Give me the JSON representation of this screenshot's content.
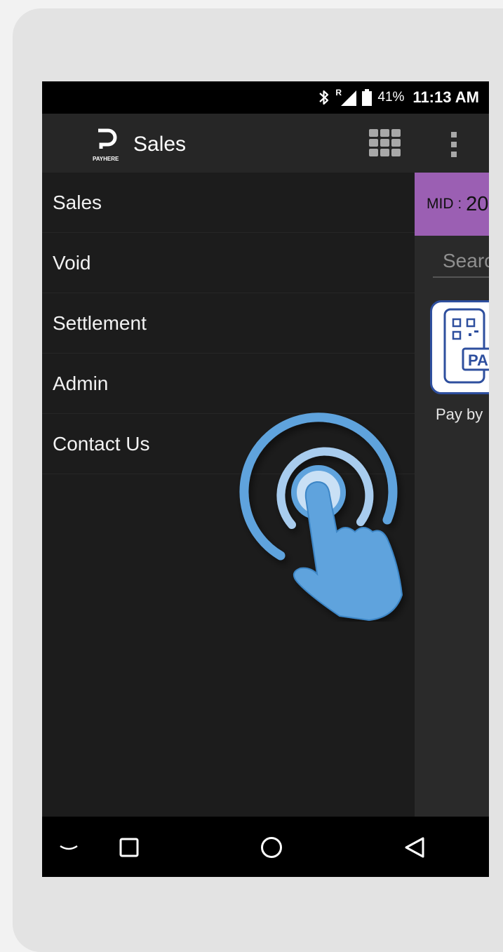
{
  "status_bar": {
    "roaming": "R",
    "battery_percent": "41%",
    "time": "11:13 AM",
    "icons": [
      "bluetooth-icon",
      "signal-icon",
      "battery-icon"
    ]
  },
  "app_bar": {
    "logo_text": "PAYHERE",
    "title": "Sales",
    "icons": [
      "grid-icon",
      "more-vert-icon"
    ]
  },
  "drawer": {
    "items": [
      {
        "label": "Sales"
      },
      {
        "label": "Void"
      },
      {
        "label": "Settlement"
      },
      {
        "label": "Admin"
      },
      {
        "label": "Contact Us"
      }
    ]
  },
  "main": {
    "mid_label": "MID :",
    "mid_value": "20",
    "search_placeholder": "Search",
    "tile_text": "PA",
    "tile_label": "Pay by"
  },
  "nav_bar": {
    "icons": [
      "collapse-icon",
      "recents-icon",
      "home-icon",
      "back-icon"
    ]
  },
  "colors": {
    "accent_purple": "#9b5fb3",
    "touch_blue": "#5ea3dd",
    "tile_border": "#2e4f9e"
  }
}
